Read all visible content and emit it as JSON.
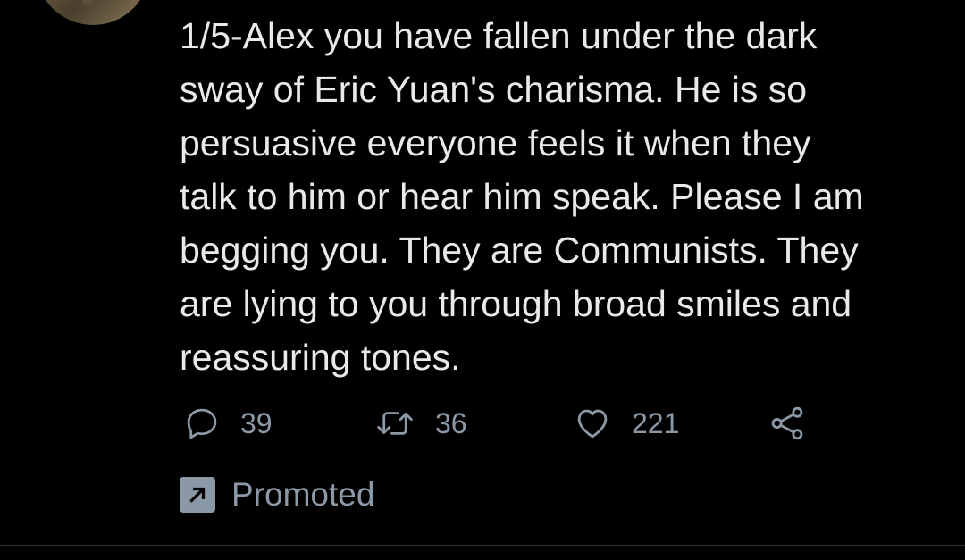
{
  "tweet": {
    "lines": [
      "1/5-Alex you have fallen under the dark",
      "sway of Eric Yuan's charisma. He is so",
      "persuasive everyone feels it when they",
      "talk to him or hear him speak. Please I am",
      "begging you. They are Communists. They",
      "are lying to you through broad smiles and",
      "reassuring tones."
    ]
  },
  "actions": {
    "replies": "39",
    "retweets": "36",
    "likes": "221"
  },
  "promoted_label": "Promoted",
  "icons": {
    "avatar": "avatar-image",
    "reply": "reply-icon",
    "retweet": "retweet-icon",
    "like": "heart-icon",
    "share": "share-icon",
    "promoted": "promoted-arrow-icon"
  },
  "colors": {
    "background": "#000000",
    "text": "#e7e9ea",
    "secondary": "#8b98a5"
  }
}
